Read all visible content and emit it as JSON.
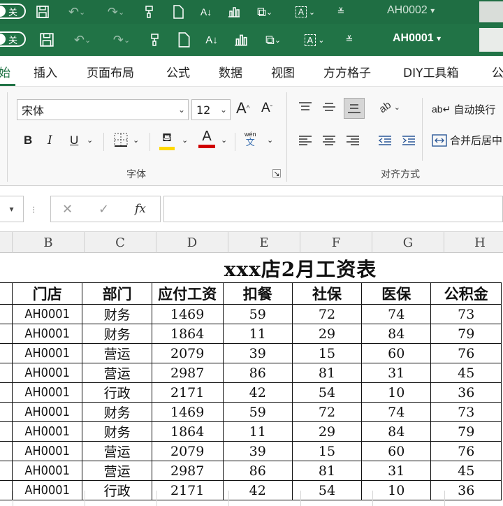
{
  "titlebar_back": {
    "pill_label": "关",
    "doc_name": "AH0002",
    "chevron": "▾"
  },
  "titlebar_front": {
    "pill_label": "关",
    "doc_name": "AH0001",
    "chevron": "▾"
  },
  "ribbon_tabs": [
    "始",
    "插入",
    "页面布局",
    "公式",
    "数据",
    "视图",
    "方方格子",
    "DIY工具箱",
    "公"
  ],
  "font_group": {
    "font_name": "宋体",
    "font_size": "12",
    "grow_font": "A",
    "shrink_font": "A",
    "bold": "B",
    "italic": "I",
    "underline": "U",
    "label": "字体",
    "phonetic_top": "wén",
    "phonetic_bottom": "文",
    "font_color_letter": "A"
  },
  "align_group": {
    "wrap_text": "自动换行",
    "merge_center": "合并后居中",
    "label": "对齐方式"
  },
  "formula_bar": {
    "cancel": "✕",
    "enter": "✓",
    "fx": "fx"
  },
  "columns": [
    "B",
    "C",
    "D",
    "E",
    "F",
    "G",
    "H"
  ],
  "sheet": {
    "title": "xxx店2月工资表",
    "headers": [
      "门店",
      "部门",
      "应付工资",
      "扣餐",
      "社保",
      "医保",
      "公积金"
    ],
    "rows": [
      [
        "AH0001",
        "财务",
        "1469",
        "59",
        "72",
        "74",
        "73"
      ],
      [
        "AH0001",
        "财务",
        "1864",
        "11",
        "29",
        "84",
        "79"
      ],
      [
        "AH0001",
        "营运",
        "2079",
        "39",
        "15",
        "60",
        "76"
      ],
      [
        "AH0001",
        "营运",
        "2987",
        "86",
        "81",
        "31",
        "45"
      ],
      [
        "AH0001",
        "行政",
        "2171",
        "42",
        "54",
        "10",
        "36"
      ],
      [
        "AH0001",
        "财务",
        "1469",
        "59",
        "72",
        "74",
        "73"
      ],
      [
        "AH0001",
        "财务",
        "1864",
        "11",
        "29",
        "84",
        "79"
      ],
      [
        "AH0001",
        "营运",
        "2079",
        "39",
        "15",
        "60",
        "76"
      ],
      [
        "AH0001",
        "营运",
        "2987",
        "86",
        "81",
        "31",
        "45"
      ],
      [
        "AH0001",
        "行政",
        "2171",
        "42",
        "54",
        "10",
        "36"
      ]
    ]
  },
  "colors": {
    "excel_green": "#217346",
    "highlight_yellow": "#ffd800",
    "font_red": "#d00000"
  }
}
